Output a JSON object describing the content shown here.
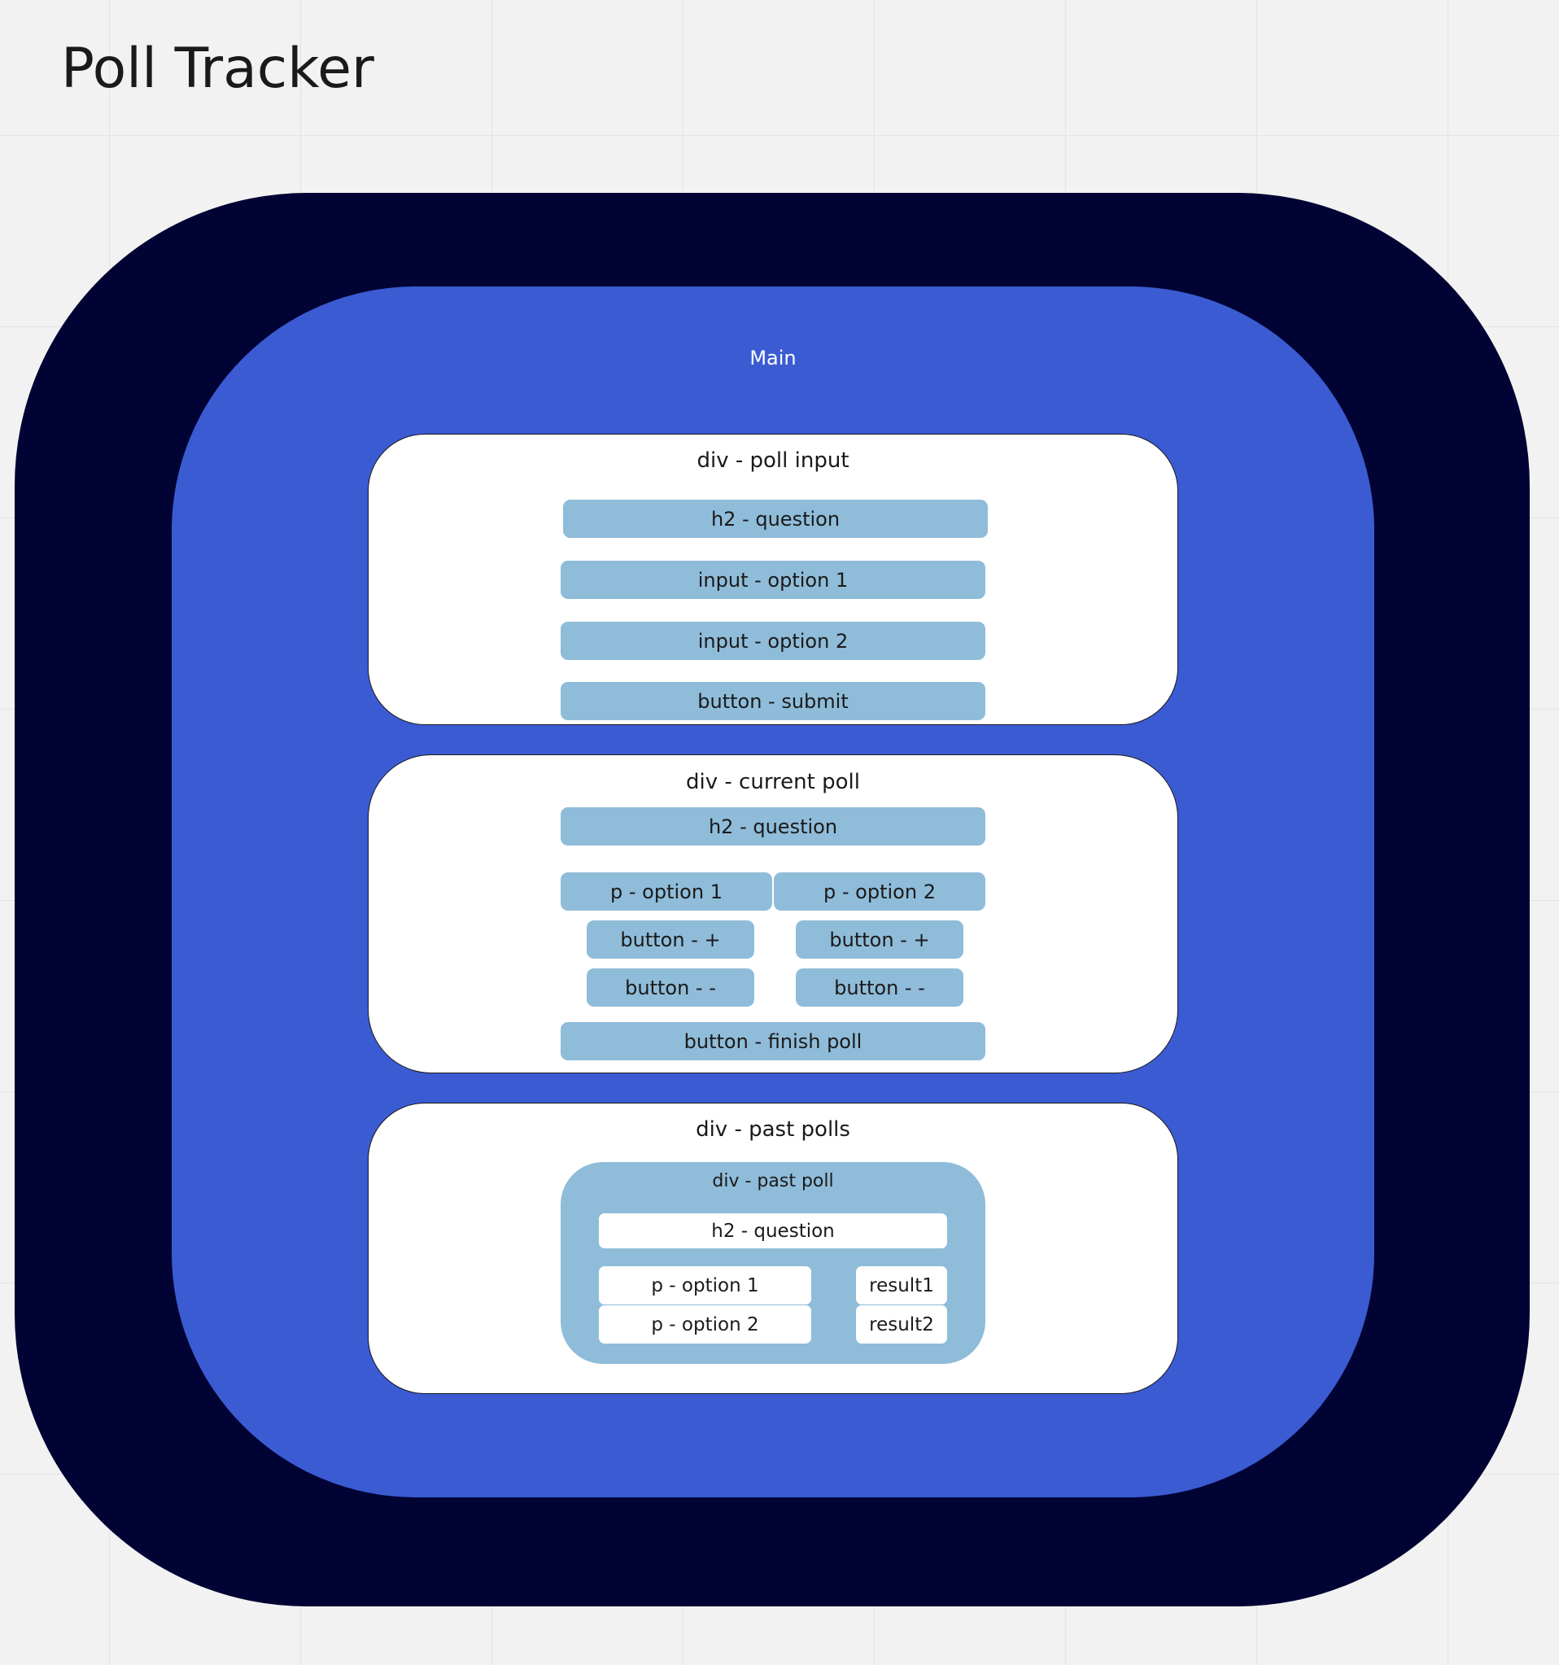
{
  "title": "Poll Tracker",
  "colors": {
    "background": "#f2f2f2",
    "outer": "#000333",
    "main": "#3b5bd3",
    "element": "#8fbcd9",
    "panel": "#ffffff"
  },
  "main": {
    "label": "Main"
  },
  "poll_input": {
    "label": "div - poll input",
    "items": [
      "h2 - question",
      "input - option 1",
      "input - option 2",
      "button - submit"
    ]
  },
  "current_poll": {
    "label": "div - current poll",
    "question": "h2 - question",
    "option1": "p - option 1",
    "option2": "p - option 2",
    "plus1": "button - +",
    "plus2": "button - +",
    "minus1": "button - -",
    "minus2": "button - -",
    "finish": "button - finish poll"
  },
  "past_polls": {
    "label": "div - past polls",
    "past_poll": {
      "label": "div - past poll",
      "question": "h2 - question",
      "option1": "p - option 1",
      "option2": "p - option 2",
      "result1": "result1",
      "result2": "result2"
    }
  }
}
